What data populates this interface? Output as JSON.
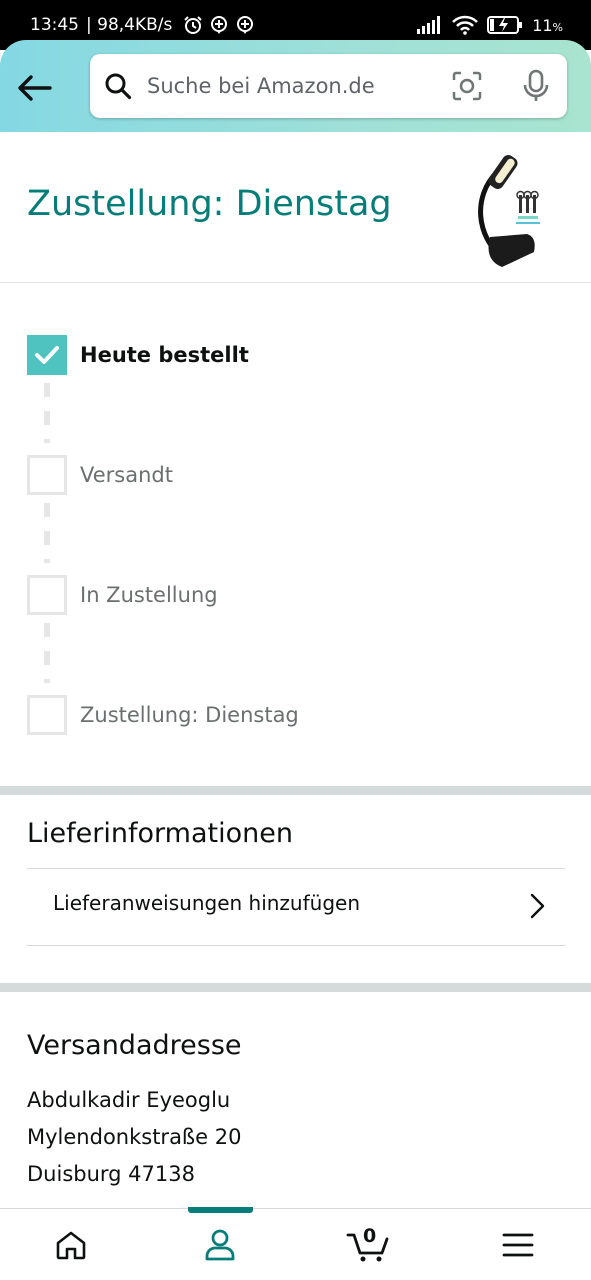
{
  "status_bar": {
    "time": "13:45",
    "network_speed": "| 98,4KB/s",
    "battery": "11",
    "battery_unit": "%"
  },
  "header": {
    "search": {
      "placeholder": "Suche bei Amazon.de"
    }
  },
  "delivery": {
    "title": "Zustellung: Dienstag"
  },
  "tracker": {
    "steps": [
      {
        "label": "Heute bestellt",
        "done": true
      },
      {
        "label": "Versandt",
        "done": false
      },
      {
        "label": "In Zustellung",
        "done": false
      },
      {
        "label": "Zustellung: Dienstag",
        "done": false
      }
    ]
  },
  "delivery_info": {
    "title": "Lieferinformationen",
    "add_instructions_label": "Lieferanweisungen hinzufügen"
  },
  "shipping_address": {
    "title": "Versandadresse",
    "name": "Abdulkadir Eyeoglu",
    "street": "Mylendonkstraße 20",
    "city": "Duisburg 47138"
  },
  "bottom_nav": {
    "cart_count": "0",
    "active": "account",
    "accent_color": "#067d78"
  },
  "colors": {
    "title_teal": "#067d78",
    "check_teal": "#4ec3bf",
    "header_gradient_start": "#84d8e3",
    "header_gradient_end": "#a8e4cf"
  }
}
